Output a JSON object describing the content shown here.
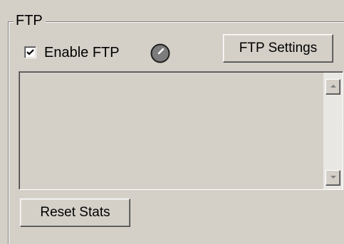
{
  "group": {
    "title": "FTP"
  },
  "enable_ftp": {
    "label": "Enable FTP",
    "checked": true
  },
  "status_indicator": {
    "icon": "status-led-icon",
    "color": "#808080"
  },
  "buttons": {
    "ftp_settings": "FTP Settings",
    "reset_stats": "Reset Stats"
  },
  "log": {
    "lines": []
  },
  "scrollbar": {
    "up_icon": "arrow-up-icon",
    "down_icon": "arrow-down-icon"
  }
}
